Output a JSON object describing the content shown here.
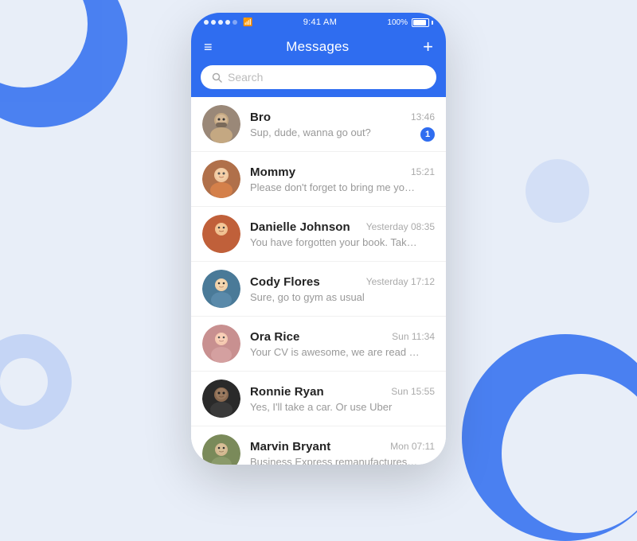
{
  "colors": {
    "accent": "#2f6df0",
    "background": "#e8eef8"
  },
  "statusBar": {
    "dots": [
      "full",
      "full",
      "full",
      "full",
      "dim"
    ],
    "wifi": "WiFi",
    "time": "9:41 AM",
    "battery": "100%"
  },
  "header": {
    "title": "Messages",
    "menu_label": "≡",
    "add_label": "+"
  },
  "search": {
    "placeholder": "Search",
    "icon": "🔍"
  },
  "messages": [
    {
      "id": 1,
      "name": "Bro",
      "preview": "Sup, dude, wanna go out?",
      "time": "13:46",
      "unread": 1,
      "avatarColor": "av-gray",
      "avatarEmoji": "👨"
    },
    {
      "id": 2,
      "name": "Mommy",
      "preview": "Please don't forget to bring me yo…",
      "time": "15:21",
      "unread": 0,
      "avatarColor": "av-warm",
      "avatarEmoji": "👩"
    },
    {
      "id": 3,
      "name": "Danielle Johnson",
      "preview": "You have forgotten your book. Tak…",
      "time": "Yesterday 08:35",
      "unread": 0,
      "avatarColor": "av-orange",
      "avatarEmoji": "👩"
    },
    {
      "id": 4,
      "name": "Cody Flores",
      "preview": "Sure, go to gym as usual",
      "time": "Yesterday 17:12",
      "unread": 0,
      "avatarColor": "av-teal",
      "avatarEmoji": "👦"
    },
    {
      "id": 5,
      "name": "Ora Rice",
      "preview": "Your CV is awesome, we are read …",
      "time": "Sun 11:34",
      "unread": 0,
      "avatarColor": "av-pink",
      "avatarEmoji": "👩"
    },
    {
      "id": 6,
      "name": "Ronnie Ryan",
      "preview": "Yes, I'll take a car. Or use Uber",
      "time": "Sun 15:55",
      "unread": 0,
      "avatarColor": "av-dark",
      "avatarEmoji": "👨"
    },
    {
      "id": 7,
      "name": "Marvin Bryant",
      "preview": "Business Express remanufactures…",
      "time": "Mon 07:11",
      "unread": 0,
      "avatarColor": "av-green",
      "avatarEmoji": "👨"
    }
  ]
}
